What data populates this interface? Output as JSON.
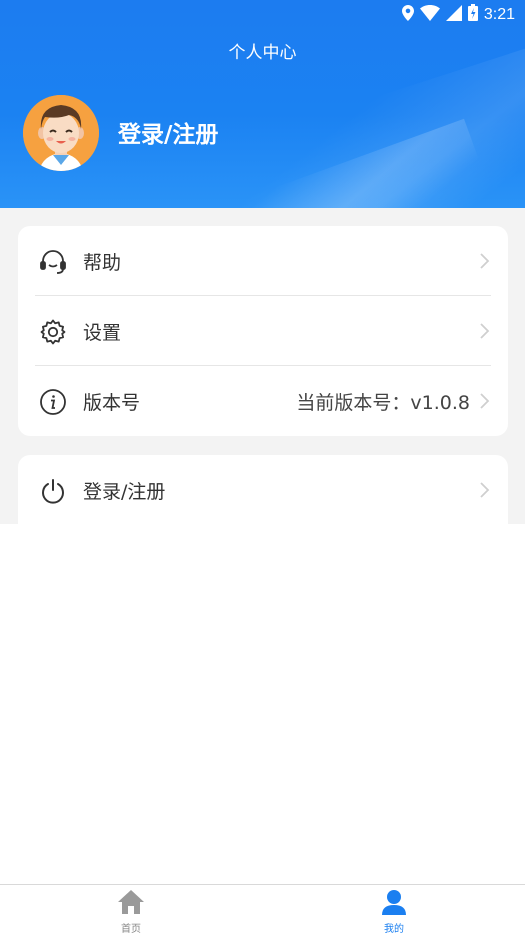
{
  "status_bar": {
    "time": "3:21",
    "icons": [
      "location-icon",
      "wifi-icon",
      "signal-icon",
      "battery-icon"
    ]
  },
  "header": {
    "title": "个人中心",
    "login_label": "登录/注册",
    "avatar": "avatar-cartoon-man"
  },
  "menu": {
    "items": [
      {
        "icon": "headset-icon",
        "label": "帮助",
        "value": ""
      },
      {
        "icon": "gear-icon",
        "label": "设置",
        "value": ""
      },
      {
        "icon": "info-icon",
        "label": "版本号",
        "value": "当前版本号：v1.0.8"
      }
    ],
    "login": {
      "icon": "power-icon",
      "label": "登录/注册"
    }
  },
  "tabbar": {
    "tabs": [
      {
        "icon": "home-icon",
        "label": "首页",
        "active": false
      },
      {
        "icon": "user-icon",
        "label": "我的",
        "active": true
      }
    ]
  },
  "colors": {
    "accent": "#1b7ff0",
    "header_bg": "#1c7cf0",
    "page_bg": "#f3f3f3",
    "inactive_tab": "#888888"
  }
}
